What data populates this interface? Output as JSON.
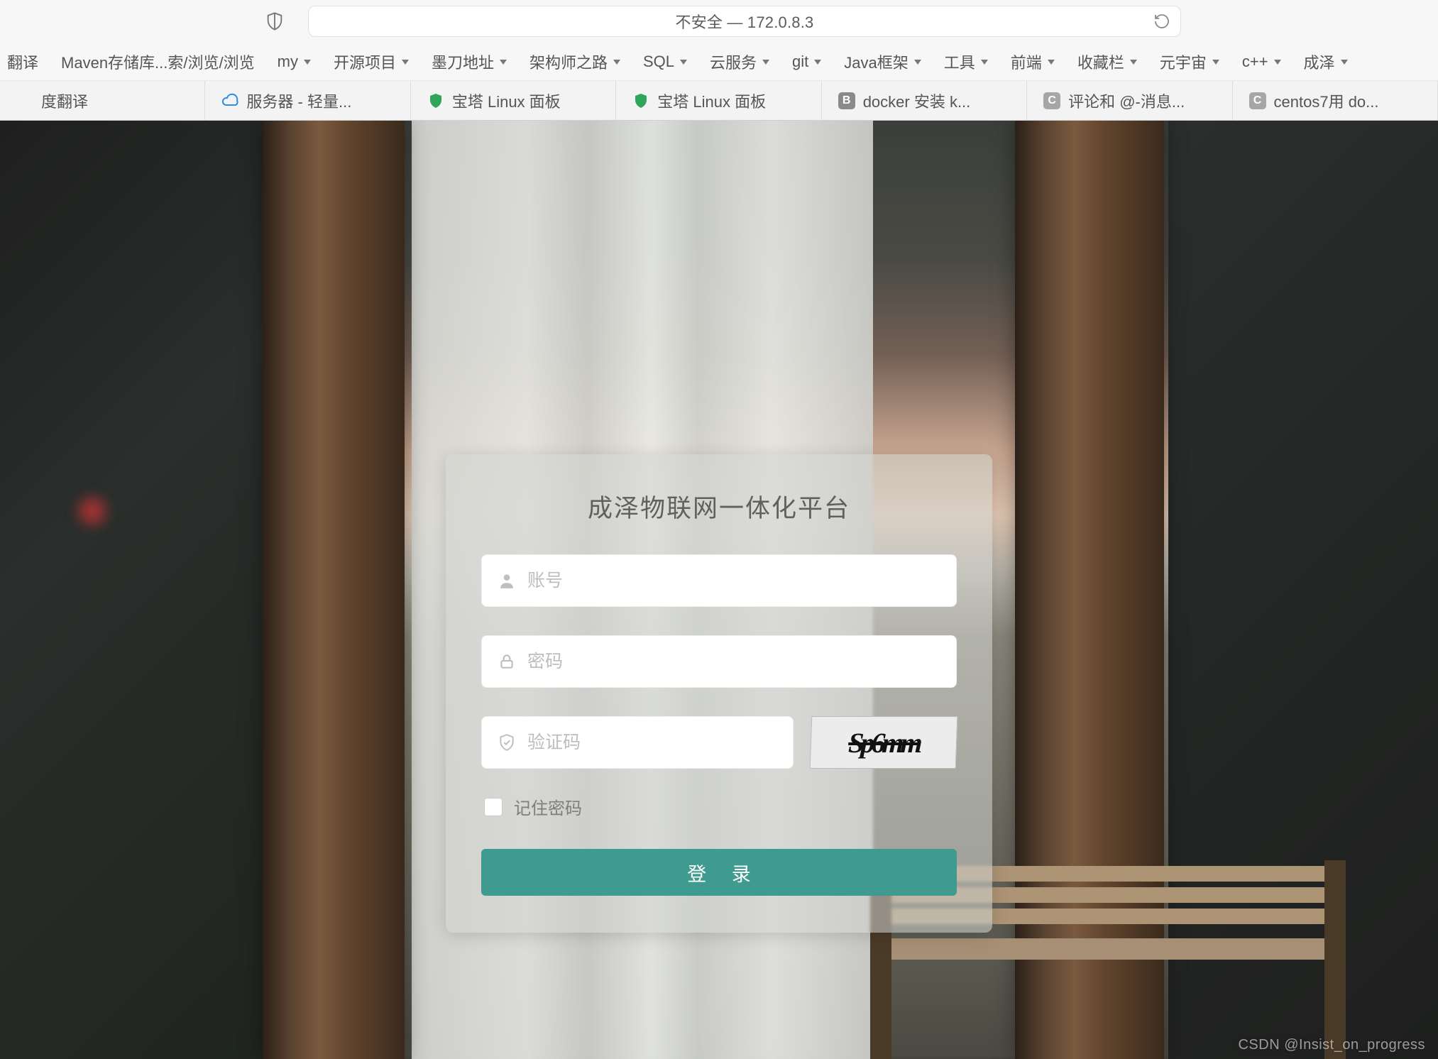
{
  "addressBar": {
    "text": "不安全 — 172.0.8.3"
  },
  "bookmarks": [
    {
      "label": "翻译",
      "dropdown": false
    },
    {
      "label": "Maven存储库...索/浏览/浏览",
      "dropdown": false
    },
    {
      "label": "my",
      "dropdown": true
    },
    {
      "label": "开源项目",
      "dropdown": true
    },
    {
      "label": "墨刀地址",
      "dropdown": true
    },
    {
      "label": "架构师之路",
      "dropdown": true
    },
    {
      "label": "SQL",
      "dropdown": true
    },
    {
      "label": "云服务",
      "dropdown": true
    },
    {
      "label": "git",
      "dropdown": true
    },
    {
      "label": "Java框架",
      "dropdown": true
    },
    {
      "label": "工具",
      "dropdown": true
    },
    {
      "label": "前端",
      "dropdown": true
    },
    {
      "label": "收藏栏",
      "dropdown": true
    },
    {
      "label": "元宇宙",
      "dropdown": true
    },
    {
      "label": "c++",
      "dropdown": true
    },
    {
      "label": "成泽",
      "dropdown": true
    }
  ],
  "tabs": [
    {
      "label": "度翻译",
      "faviconType": "none"
    },
    {
      "label": "服务器 - 轻量...",
      "faviconType": "cloud"
    },
    {
      "label": "宝塔 Linux 面板",
      "faviconType": "shield-green"
    },
    {
      "label": "宝塔 Linux 面板",
      "faviconType": "shield-green"
    },
    {
      "label": "docker 安装 k...",
      "faviconType": "box-b"
    },
    {
      "label": "评论和 @-消息...",
      "faviconType": "box-c"
    },
    {
      "label": "centos7用 do...",
      "faviconType": "box-c"
    }
  ],
  "login": {
    "title": "成泽物联网一体化平台",
    "usernamePlaceholder": "账号",
    "passwordPlaceholder": "密码",
    "captchaPlaceholder": "验证码",
    "captchaText": "Sp6mm",
    "rememberLabel": "记住密码",
    "submitLabel": "登 录"
  },
  "watermark": "CSDN @Insist_on_progress"
}
